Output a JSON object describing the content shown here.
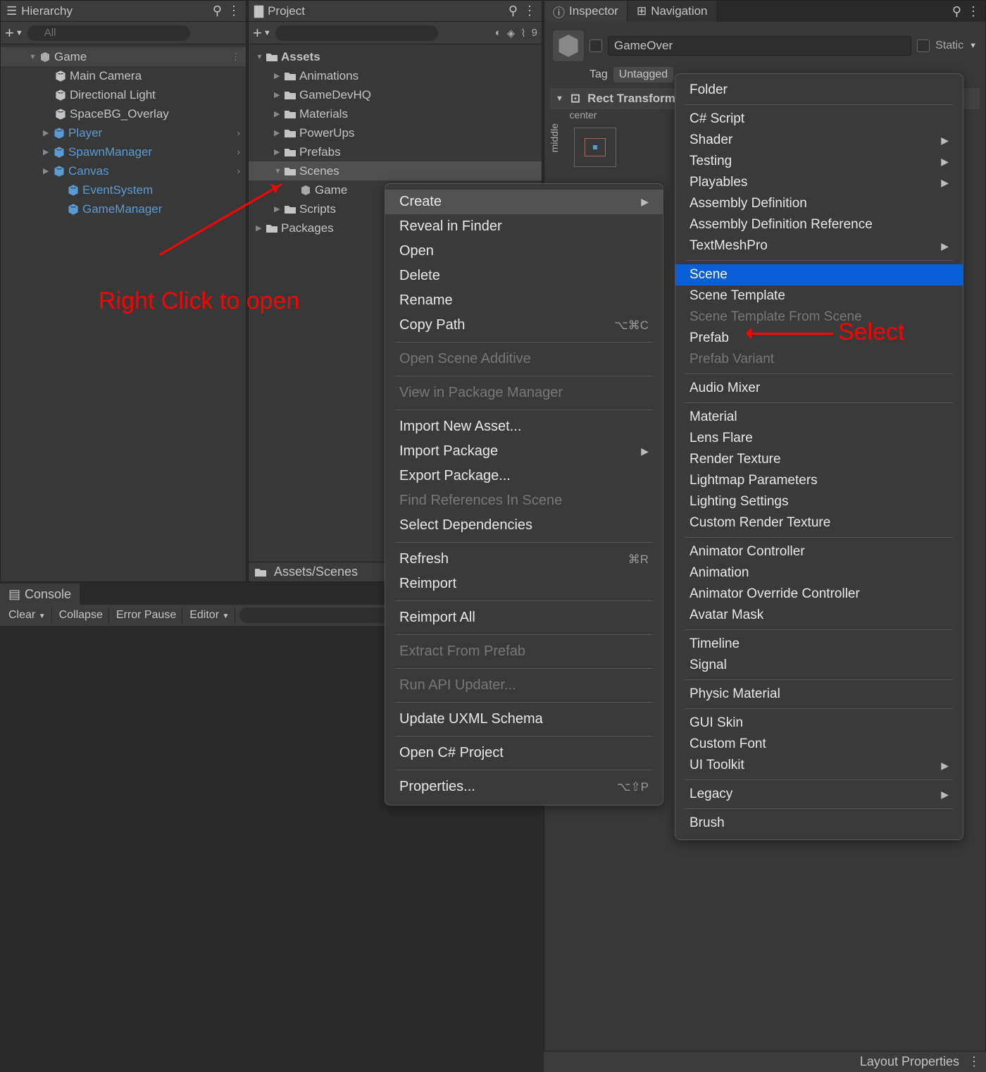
{
  "hierarchy": {
    "title": "Hierarchy",
    "search_placeholder": "All",
    "root": "Game",
    "items": [
      {
        "name": "Main Camera",
        "prefab": false,
        "indent": 2
      },
      {
        "name": "Directional Light",
        "prefab": false,
        "indent": 2
      },
      {
        "name": "SpaceBG_Overlay",
        "prefab": false,
        "indent": 2
      },
      {
        "name": "Player",
        "prefab": true,
        "indent": 2,
        "expand": true,
        "arrow": true
      },
      {
        "name": "SpawnManager",
        "prefab": true,
        "indent": 2,
        "expand": true,
        "arrow": true
      },
      {
        "name": "Canvas",
        "prefab": true,
        "indent": 2,
        "expand": true,
        "arrow": true
      },
      {
        "name": "EventSystem",
        "prefab": true,
        "indent": 3
      },
      {
        "name": "GameManager",
        "prefab": true,
        "indent": 3
      }
    ]
  },
  "project": {
    "title": "Project",
    "hidden_count": "9",
    "root": "Assets",
    "folders": [
      "Animations",
      "GameDevHQ",
      "Materials",
      "PowerUps",
      "Prefabs"
    ],
    "scenes_folder": "Scenes",
    "scene_item": "Game",
    "scripts_folder": "Scripts",
    "packages": "Packages",
    "breadcrumb": "Assets/Scenes"
  },
  "inspector": {
    "tab1": "Inspector",
    "tab2": "Navigation",
    "go_name": "GameOver",
    "static_label": "Static",
    "tag_label": "Tag",
    "tag_value": "Untagged",
    "rect_transform": "Rect Transform",
    "anchor_center": "center",
    "anchor_middle": "middle",
    "layout_props": "Layout Properties"
  },
  "console": {
    "title": "Console",
    "buttons": [
      "Clear",
      "Collapse",
      "Error Pause",
      "Editor"
    ]
  },
  "context_menu": {
    "items": [
      {
        "label": "Create",
        "submenu": true,
        "hl": true
      },
      {
        "label": "Reveal in Finder"
      },
      {
        "label": "Open"
      },
      {
        "label": "Delete"
      },
      {
        "label": "Rename"
      },
      {
        "label": "Copy Path",
        "shortcut": "⌥⌘C"
      },
      {
        "sep": true
      },
      {
        "label": "Open Scene Additive",
        "disabled": true
      },
      {
        "sep": true
      },
      {
        "label": "View in Package Manager",
        "disabled": true
      },
      {
        "sep": true
      },
      {
        "label": "Import New Asset..."
      },
      {
        "label": "Import Package",
        "submenu": true
      },
      {
        "label": "Export Package..."
      },
      {
        "label": "Find References In Scene",
        "disabled": true
      },
      {
        "label": "Select Dependencies"
      },
      {
        "sep": true
      },
      {
        "label": "Refresh",
        "shortcut": "⌘R"
      },
      {
        "label": "Reimport"
      },
      {
        "sep": true
      },
      {
        "label": "Reimport All"
      },
      {
        "sep": true
      },
      {
        "label": "Extract From Prefab",
        "disabled": true
      },
      {
        "sep": true
      },
      {
        "label": "Run API Updater...",
        "disabled": true
      },
      {
        "sep": true
      },
      {
        "label": "Update UXML Schema"
      },
      {
        "sep": true
      },
      {
        "label": "Open C# Project"
      },
      {
        "sep": true
      },
      {
        "label": "Properties...",
        "shortcut": "⌥⇧P"
      }
    ]
  },
  "create_menu": {
    "items": [
      {
        "label": "Folder"
      },
      {
        "sep": true
      },
      {
        "label": "C# Script"
      },
      {
        "label": "Shader",
        "submenu": true
      },
      {
        "label": "Testing",
        "submenu": true
      },
      {
        "label": "Playables",
        "submenu": true
      },
      {
        "label": "Assembly Definition"
      },
      {
        "label": "Assembly Definition Reference"
      },
      {
        "label": "TextMeshPro",
        "submenu": true
      },
      {
        "sep": true
      },
      {
        "label": "Scene",
        "selected": true
      },
      {
        "label": "Scene Template"
      },
      {
        "label": "Scene Template From Scene",
        "disabled": true
      },
      {
        "label": "Prefab"
      },
      {
        "label": "Prefab Variant",
        "disabled": true
      },
      {
        "sep": true
      },
      {
        "label": "Audio Mixer"
      },
      {
        "sep": true
      },
      {
        "label": "Material"
      },
      {
        "label": "Lens Flare"
      },
      {
        "label": "Render Texture"
      },
      {
        "label": "Lightmap Parameters"
      },
      {
        "label": "Lighting Settings"
      },
      {
        "label": "Custom Render Texture"
      },
      {
        "sep": true
      },
      {
        "label": "Animator Controller"
      },
      {
        "label": "Animation"
      },
      {
        "label": "Animator Override Controller"
      },
      {
        "label": "Avatar Mask"
      },
      {
        "sep": true
      },
      {
        "label": "Timeline"
      },
      {
        "label": "Signal"
      },
      {
        "sep": true
      },
      {
        "label": "Physic Material"
      },
      {
        "sep": true
      },
      {
        "label": "GUI Skin"
      },
      {
        "label": "Custom Font"
      },
      {
        "label": "UI Toolkit",
        "submenu": true
      },
      {
        "sep": true
      },
      {
        "label": "Legacy",
        "submenu": true
      },
      {
        "sep": true
      },
      {
        "label": "Brush"
      }
    ]
  },
  "annotations": {
    "right_click": "Right Click to open",
    "select": "Select"
  }
}
